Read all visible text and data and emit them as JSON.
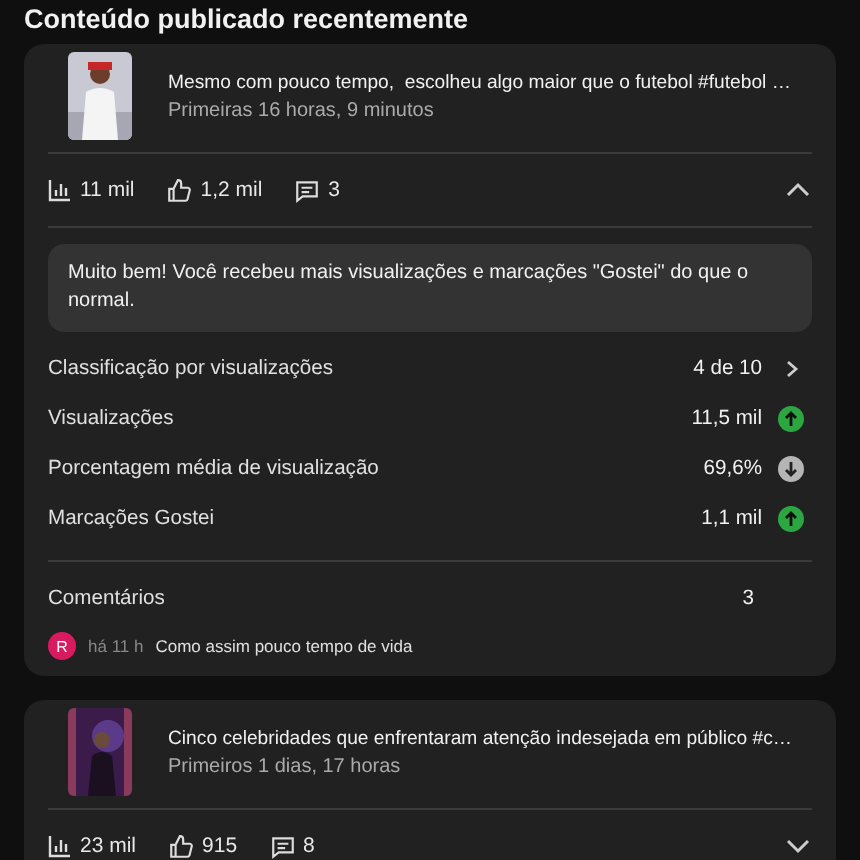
{
  "heading": "Conteúdo publicado recentemente",
  "posts": [
    {
      "title": "Mesmo com pouco tempo,  escolheu algo maior que o futebol #futebol …",
      "subtitle": "Primeiras 16 horas, 9 minutos",
      "views": "11 mil",
      "likes": "1,2 mil",
      "comments": "3",
      "expanded": true,
      "insight": "Muito bem! Você recebeu mais visualizações e marcações \"Gostei\" do que o normal.",
      "metrics": [
        {
          "label": "Classificação por visualizações",
          "value": "4 de 10",
          "kind": "link"
        },
        {
          "label": "Visualizações",
          "value": "11,5 mil",
          "kind": "up"
        },
        {
          "label": "Porcentagem média de visualização",
          "value": "69,6%",
          "kind": "down"
        },
        {
          "label": "Marcações Gostei",
          "value": "1,1 mil",
          "kind": "up"
        }
      ],
      "comments_label": "Comentários",
      "comments_count": "3",
      "comment": {
        "initial": "R",
        "color": "#d81b60",
        "time": "há 11 h",
        "text": "Como assim pouco tempo de vida"
      }
    },
    {
      "title": "Cinco celebridades que enfrentaram atenção indesejada em público #c…",
      "subtitle": "Primeiros 1 dias, 17 horas",
      "views": "23 mil",
      "likes": "915",
      "comments": "8",
      "expanded": false
    }
  ]
}
